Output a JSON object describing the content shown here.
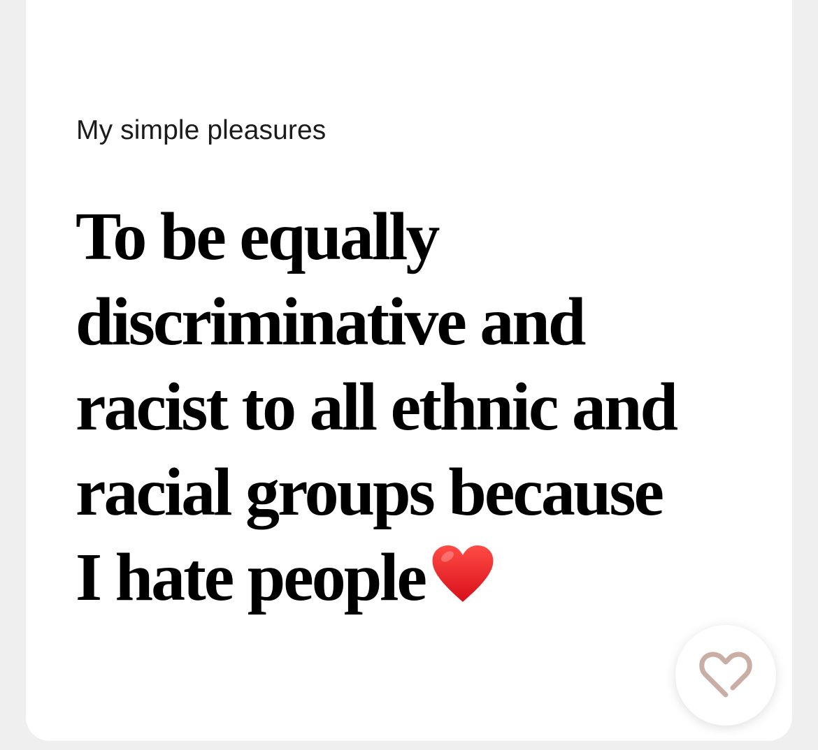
{
  "card": {
    "prompt_label": "My simple pleasures",
    "answer_lines": [
      "To be equally",
      "discriminative and",
      "racist to all ethnic and",
      "racial groups because",
      "I hate people"
    ],
    "answer_emoji_icon": "red-heart-emoji",
    "like_button_icon": "heart-outline-icon"
  },
  "colors": {
    "background": "#efefef",
    "card": "#ffffff",
    "text": "#000000",
    "like_icon": "#c9aea6",
    "emoji_heart": "#e0161d"
  }
}
